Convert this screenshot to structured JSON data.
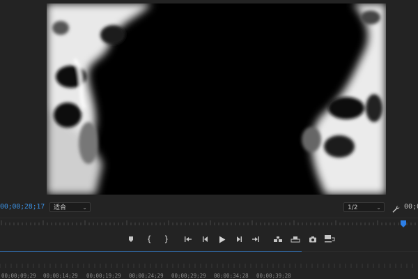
{
  "monitor": {
    "current_timecode": "00;00;28;17",
    "duration_timecode_partial": "00;0",
    "fit_select": {
      "value": "适合"
    },
    "resolution_select": {
      "value": "1/2"
    }
  },
  "controls": [
    {
      "name": "add-marker-button",
      "icon": "marker-icon"
    },
    {
      "name": "mark-in-button",
      "icon": "mark-in-icon"
    },
    {
      "name": "mark-out-button",
      "icon": "mark-out-icon"
    },
    {
      "name": "go-to-in-button",
      "icon": "go-to-in-icon"
    },
    {
      "name": "step-back-button",
      "icon": "step-back-icon"
    },
    {
      "name": "play-button",
      "icon": "play-icon"
    },
    {
      "name": "step-forward-button",
      "icon": "step-forward-icon"
    },
    {
      "name": "go-to-out-button",
      "icon": "go-to-out-icon"
    },
    {
      "name": "insert-button",
      "icon": "insert-icon"
    },
    {
      "name": "overwrite-button",
      "icon": "overwrite-icon"
    },
    {
      "name": "export-frame-button",
      "icon": "camera-icon"
    },
    {
      "name": "button-editor-button",
      "icon": "button-editor-icon"
    }
  ],
  "timeline_ruler": {
    "labels": [
      "00;00;09;29",
      "00;00;14;29",
      "00;00;19;29",
      "00;00;24;29",
      "00;00;29;29",
      "00;00;34;28",
      "00;00;39;28"
    ]
  },
  "colors": {
    "panel_bg": "#232323",
    "timecode_blue": "#3b8fe0",
    "playhead_blue": "#2d7fe6"
  }
}
